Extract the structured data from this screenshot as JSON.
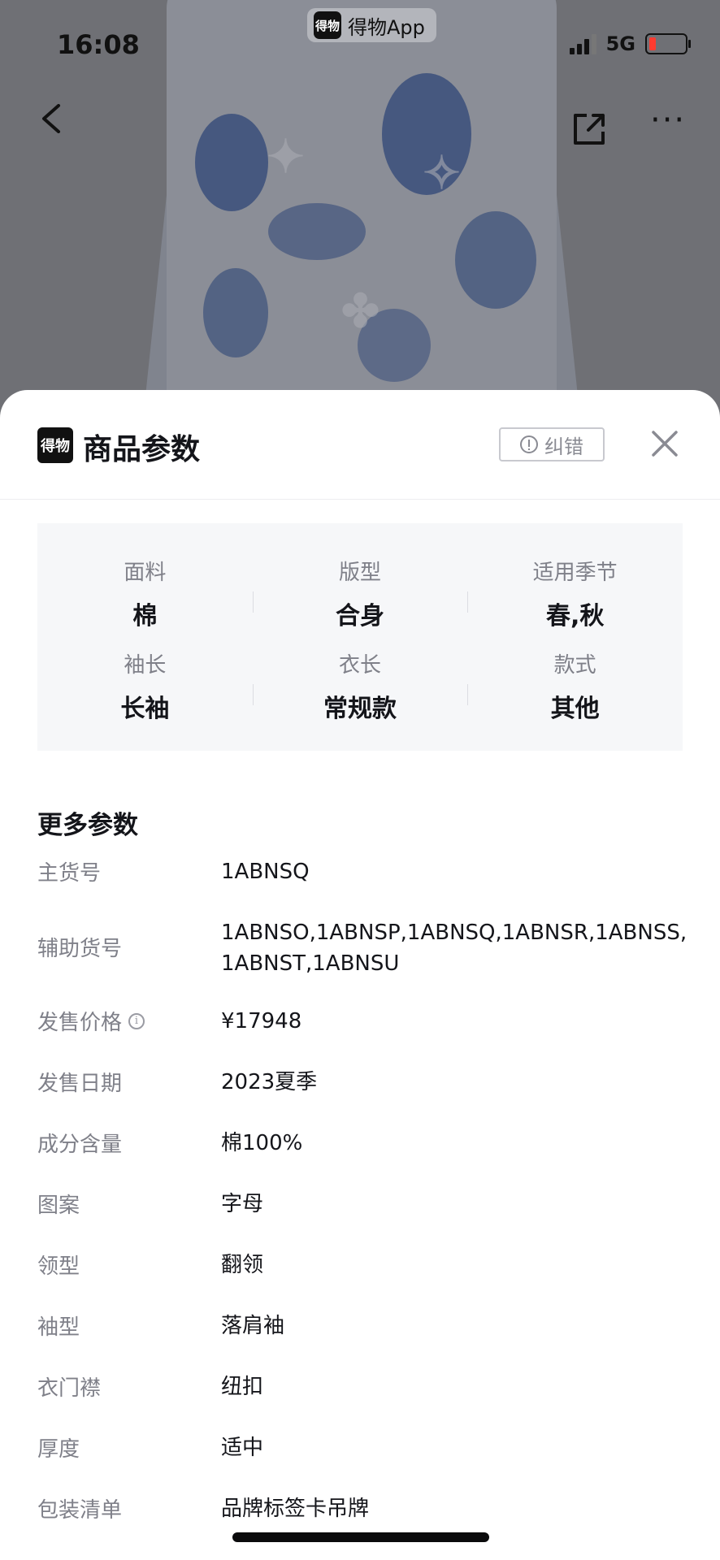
{
  "status_bar": {
    "time": "16:08",
    "app_name": "得物App",
    "app_logo_text": "得物",
    "network": "5G",
    "battery_color": "#ff3b30",
    "battery_level": 0.2
  },
  "nav": {
    "back_icon": "chevron-left-icon",
    "share_icon": "share-icon",
    "more_label": "···"
  },
  "sheet": {
    "logo_text": "得物",
    "title": "商品参数",
    "report_label": "纠错",
    "close_icon": "close-icon"
  },
  "key_params": [
    {
      "label": "面料",
      "value": "棉"
    },
    {
      "label": "版型",
      "value": "合身"
    },
    {
      "label": "适用季节",
      "value": "春,秋"
    },
    {
      "label": "袖长",
      "value": "长袖"
    },
    {
      "label": "衣长",
      "value": "常规款"
    },
    {
      "label": "款式",
      "value": "其他"
    }
  ],
  "more": {
    "title": "更多参数",
    "rows": [
      {
        "label": "主货号",
        "value": "1ABNSQ"
      },
      {
        "label": "辅助货号",
        "value": "1ABNSO,1ABNSP,1ABNSQ,1ABNSR,1ABNSS,1ABNST,1ABNSU"
      },
      {
        "label": "发售价格",
        "value": "¥17948"
      },
      {
        "label": "发售日期",
        "value": "2023夏季"
      },
      {
        "label": "成分含量",
        "value": "棉100%"
      },
      {
        "label": "图案",
        "value": "字母"
      },
      {
        "label": "领型",
        "value": "翻领"
      },
      {
        "label": "袖型",
        "value": "落肩袖"
      },
      {
        "label": "衣门襟",
        "value": "纽扣"
      },
      {
        "label": "厚度",
        "value": "适中"
      },
      {
        "label": "包装清单",
        "value": "品牌标签卡吊牌"
      }
    ]
  }
}
